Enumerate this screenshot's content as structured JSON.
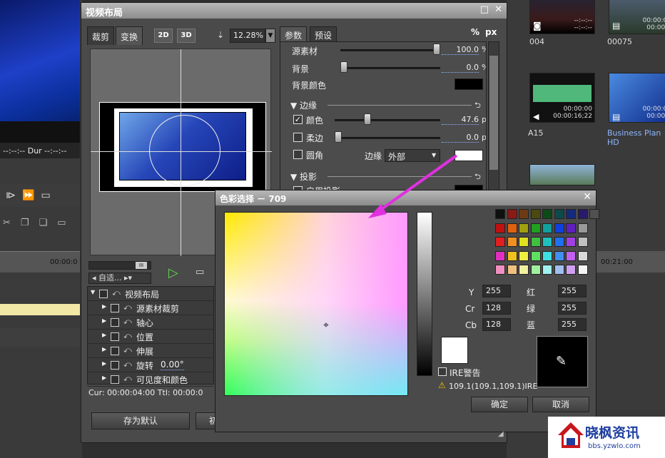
{
  "background": {
    "timecode_row": "--:--:-- Dur --:--:--",
    "ruler_left": "00:00:0",
    "ruler_right": "00:21:00",
    "thumbnails": [
      {
        "label": "004",
        "tc": "--:--:--\n--:--:--"
      },
      {
        "label": "00075",
        "tc": "00:00:00\n00:00:0"
      },
      {
        "label": "A15",
        "tc": "00:00:00\n00:00:16;22"
      },
      {
        "label": "Business Plan HD",
        "tc": "00:00:00\n00:00:0"
      }
    ]
  },
  "layout_dialog": {
    "title": "视频布局",
    "tabs": {
      "crop": "裁剪",
      "transform": "变换"
    },
    "mode_2d": "2D",
    "mode_3d": "3D",
    "zoom": "12.28%",
    "preset_select": "自适...",
    "tree": [
      {
        "label": "视频布局",
        "level": 0
      },
      {
        "label": "源素材裁剪",
        "level": 1
      },
      {
        "label": "轴心",
        "level": 1
      },
      {
        "label": "位置",
        "level": 1
      },
      {
        "label": "伸展",
        "level": 1
      },
      {
        "label": "旋转",
        "value": "0.00°",
        "level": 1
      },
      {
        "label": "可见度和颜色",
        "level": 1
      }
    ],
    "timecode": "Cur: 00:00:04:00  Ttl: 00:00:0",
    "save_default": "存为默认",
    "second_button": "初"
  },
  "param_panel": {
    "tabs": {
      "params": "参数",
      "presets": "预设"
    },
    "units": {
      "percent": "%",
      "px": "px"
    },
    "source_label": "源素材",
    "source_value": "100.0",
    "source_unit": "%",
    "source_level": 1.0,
    "background_label": "背景",
    "background_value": "0.0",
    "background_unit": "%",
    "background_level": 0.0,
    "bg_color_label": "背景颜色",
    "border_section": "边缘",
    "color_label": "颜色",
    "color_checked": true,
    "color_value": "47.6",
    "color_unit": "px",
    "color_level": 0.3,
    "soft_label": "柔边",
    "soft_value": "0.0",
    "soft_unit": "px",
    "soft_level": 0.0,
    "round_label": "圆角",
    "edge_label": "边缘",
    "edge_option": "外部",
    "shadow_section": "投影",
    "enable_shadow_label": "启用投影",
    "colors": {
      "bg_color": "#000000",
      "border_color": "#ffffff",
      "shadow_color": "#000000"
    }
  },
  "color_picker": {
    "title": "色彩选择 － 709",
    "ire_warning": "IRE警告",
    "warning_text": "109.1(109.1,109.1)IRE",
    "fields": [
      {
        "label": "Y",
        "value": "255"
      },
      {
        "label": "Cr",
        "value": "128"
      },
      {
        "label": "Cb",
        "value": "128"
      }
    ],
    "rgb_fields": [
      {
        "label": "红",
        "value": "255"
      },
      {
        "label": "绿",
        "value": "255"
      },
      {
        "label": "蓝",
        "value": "255"
      }
    ],
    "ok": "确定",
    "cancel": "取消",
    "selected_color": "#ffffff",
    "palette": [
      [
        "#101010",
        "#8a1a14",
        "#6e3a12",
        "#4a4a10",
        "#0e4a18",
        "#0e4a4a",
        "#142a7a",
        "#2a1a6a",
        "#505050"
      ],
      [
        "#c01010",
        "#e06010",
        "#a0a010",
        "#20a020",
        "#10a0a0",
        "#1040e0",
        "#6020c0",
        "#9a9a9a"
      ],
      [
        "#e02020",
        "#f09020",
        "#e0e020",
        "#40c040",
        "#20c0c0",
        "#2070f0",
        "#a040e0",
        "#c0c0c0"
      ],
      [
        "#e030c0",
        "#f0c020",
        "#f0f040",
        "#60e060",
        "#40e0e0",
        "#4090f0",
        "#c060f0",
        "#d8d8d8"
      ],
      [
        "#f090c0",
        "#f0c080",
        "#f0f0a0",
        "#a0f0a0",
        "#a0f0f0",
        "#a0c0f0",
        "#d0a0f0",
        "#f4f4f4"
      ]
    ]
  },
  "watermark": {
    "brand": "晓枫资讯",
    "url": "bbs.yzwlo.com"
  }
}
